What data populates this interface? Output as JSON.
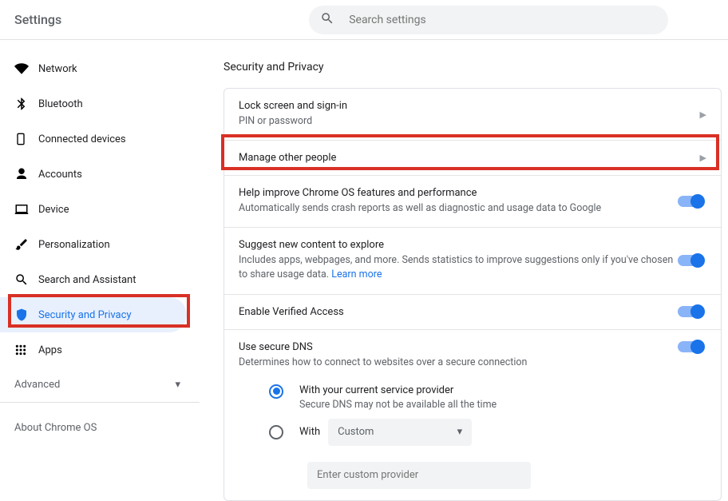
{
  "header": {
    "title": "Settings",
    "search_placeholder": "Search settings"
  },
  "sidebar": {
    "items": [
      {
        "label": "Network"
      },
      {
        "label": "Bluetooth"
      },
      {
        "label": "Connected devices"
      },
      {
        "label": "Accounts"
      },
      {
        "label": "Device"
      },
      {
        "label": "Personalization"
      },
      {
        "label": "Search and Assistant"
      },
      {
        "label": "Security and Privacy"
      },
      {
        "label": "Apps"
      }
    ],
    "advanced": "Advanced",
    "about": "About Chrome OS"
  },
  "section": {
    "heading": "Security and Privacy"
  },
  "rows": {
    "lock": {
      "title": "Lock screen and sign-in",
      "sub": "PIN or password"
    },
    "people": {
      "title": "Manage other people"
    },
    "improve": {
      "title": "Help improve Chrome OS features and performance",
      "sub": "Automatically sends crash reports as well as diagnostic and usage data to Google"
    },
    "suggest": {
      "title": "Suggest new content to explore",
      "sub": "Includes apps, webpages, and more. Sends statistics to improve suggestions only if you've chosen to share usage data.  ",
      "learn": "Learn more"
    },
    "verified": {
      "title": "Enable Verified Access"
    },
    "dns": {
      "title": "Use secure DNS",
      "sub": "Determines how to connect to websites over a secure connection",
      "opt_current": {
        "l1": "With your current service provider",
        "l2": "Secure DNS may not be available all the time"
      },
      "opt_custom": {
        "l1": "With",
        "select": "Custom",
        "placeholder": "Enter custom provider"
      }
    }
  }
}
